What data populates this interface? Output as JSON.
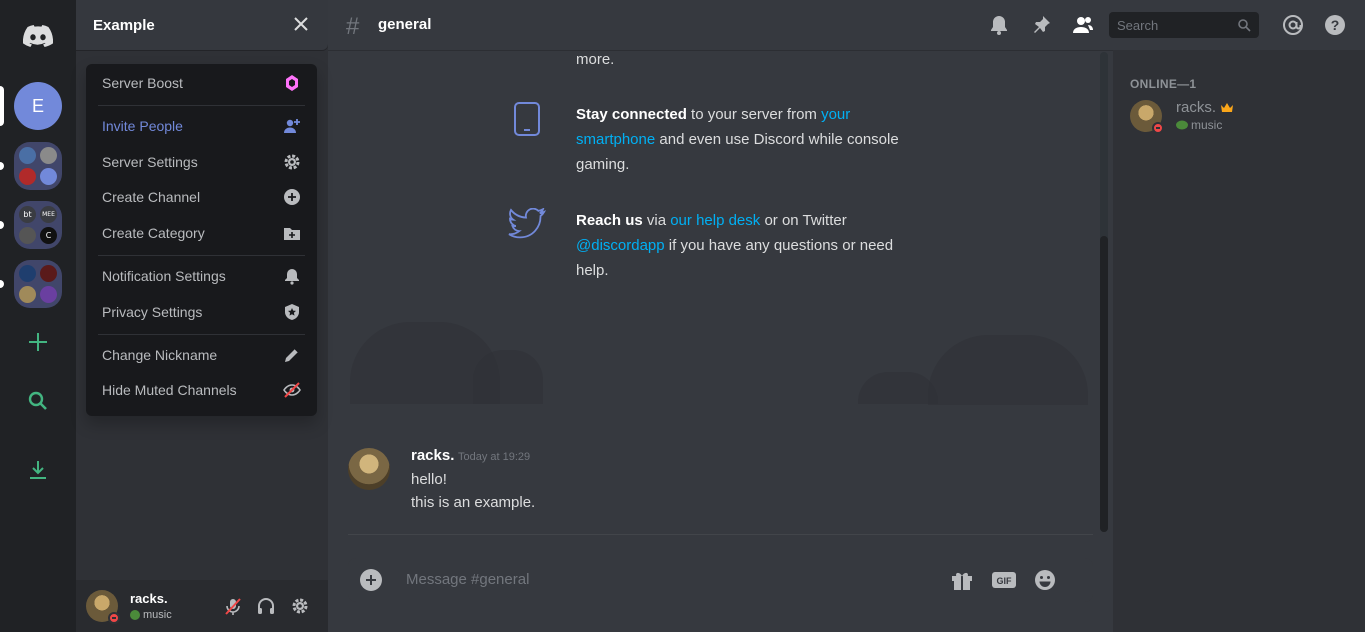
{
  "server_rail": {
    "active_server_initial": "E",
    "folder2_icons": [
      "bt",
      "MEE",
      "",
      "C"
    ]
  },
  "sidebar": {
    "server_name": "Example",
    "user": {
      "name": "racks.",
      "status": "music"
    }
  },
  "menu": {
    "items": [
      {
        "label": "Server Boost",
        "icon": "boost-gem-icon"
      },
      {
        "label": "Invite People",
        "icon": "add-person-icon"
      },
      {
        "label": "Server Settings",
        "icon": "gear-icon"
      },
      {
        "label": "Create Channel",
        "icon": "plus-circle-icon"
      },
      {
        "label": "Create Category",
        "icon": "folder-plus-icon"
      },
      {
        "label": "Notification Settings",
        "icon": "bell-icon"
      },
      {
        "label": "Privacy Settings",
        "icon": "shield-icon"
      },
      {
        "label": "Change Nickname",
        "icon": "pencil-icon"
      },
      {
        "label": "Hide Muted Channels",
        "icon": "muted-eye-icon"
      }
    ]
  },
  "header": {
    "channel_name": "general",
    "search_placeholder": "Search"
  },
  "welcome": {
    "tail_text": "more.",
    "stay_connected": {
      "bold": "Stay connected",
      "t1": " to your server from ",
      "link1": "your",
      "link1b": "smartphone",
      "t2": " and even use Discord while console",
      "t3": "gaming."
    },
    "reach_us": {
      "bold": "Reach us",
      "t1": " via ",
      "link1": "our help desk",
      "t2": " or on Twitter",
      "link2": "@discordapp",
      "t3": " if you have any questions or need",
      "t4": "help."
    }
  },
  "message": {
    "author": "racks.",
    "timestamp": "Today at 19:29",
    "lines": [
      "hello!",
      "this is an example."
    ]
  },
  "composer": {
    "placeholder": "Message #general",
    "gif_label": "GIF"
  },
  "members": {
    "header": "ONLINE—1",
    "list": [
      {
        "name": "racks.",
        "status": "music"
      }
    ]
  },
  "colors": {
    "blurple": "#7289da",
    "link": "#00b0f4",
    "green": "#43b581",
    "dnd": "#f04747",
    "boost": "#ff73fa"
  }
}
